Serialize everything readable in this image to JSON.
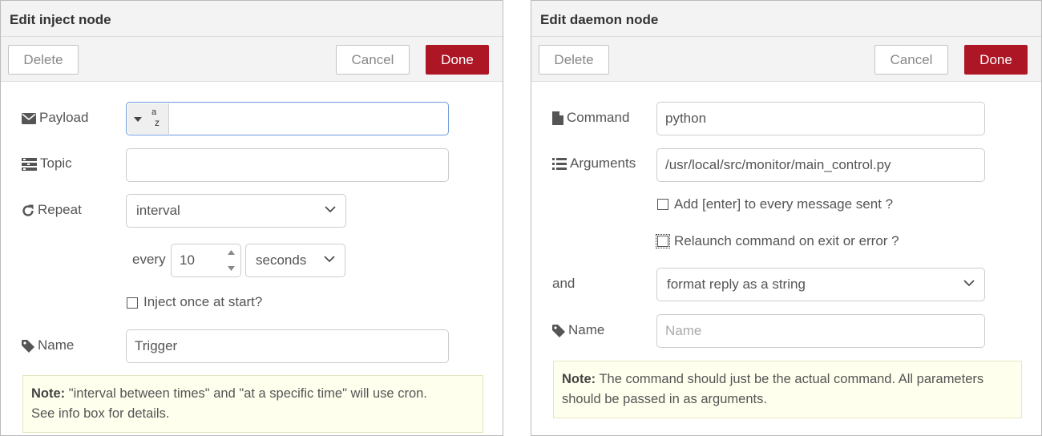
{
  "inject": {
    "title": "Edit inject node",
    "buttons": {
      "delete": "Delete",
      "cancel": "Cancel",
      "done": "Done"
    },
    "payload": {
      "label": "Payload",
      "type_icon": "string-type-icon",
      "type_top": "a",
      "type_bottom": "z",
      "value": ""
    },
    "topic": {
      "label": "Topic",
      "value": ""
    },
    "repeat": {
      "label": "Repeat",
      "value": "interval"
    },
    "every": {
      "label": "every",
      "value": "10",
      "unit": "seconds"
    },
    "inject_once": {
      "label": "Inject once at start?",
      "checked": false
    },
    "name": {
      "label": "Name",
      "value": "Trigger"
    },
    "note": {
      "bold": "Note:",
      "line1": " \"interval between times\" and \"at a specific time\" will use cron.",
      "line2": "See info box for details."
    }
  },
  "daemon": {
    "title": "Edit daemon node",
    "buttons": {
      "delete": "Delete",
      "cancel": "Cancel",
      "done": "Done"
    },
    "command": {
      "label": "Command",
      "value": "python"
    },
    "arguments": {
      "label": "Arguments",
      "value": "/usr/local/src/monitor/main_control.py"
    },
    "add_enter": {
      "label": "Add [enter] to every message sent ?",
      "checked": false
    },
    "relaunch": {
      "label": "Relaunch command on exit or error ?",
      "checked": false
    },
    "and": {
      "label": "and",
      "value": "format reply as a string"
    },
    "name": {
      "label": "Name",
      "placeholder": "Name",
      "value": ""
    },
    "note": {
      "bold": "Note:",
      "line1": " The command should just be the actual command. All parameters",
      "line2": "should be passed in as arguments."
    }
  },
  "colors": {
    "primary": "#ad1625",
    "focus_border": "#6f9bd9",
    "note_bg": "#ffffee"
  }
}
